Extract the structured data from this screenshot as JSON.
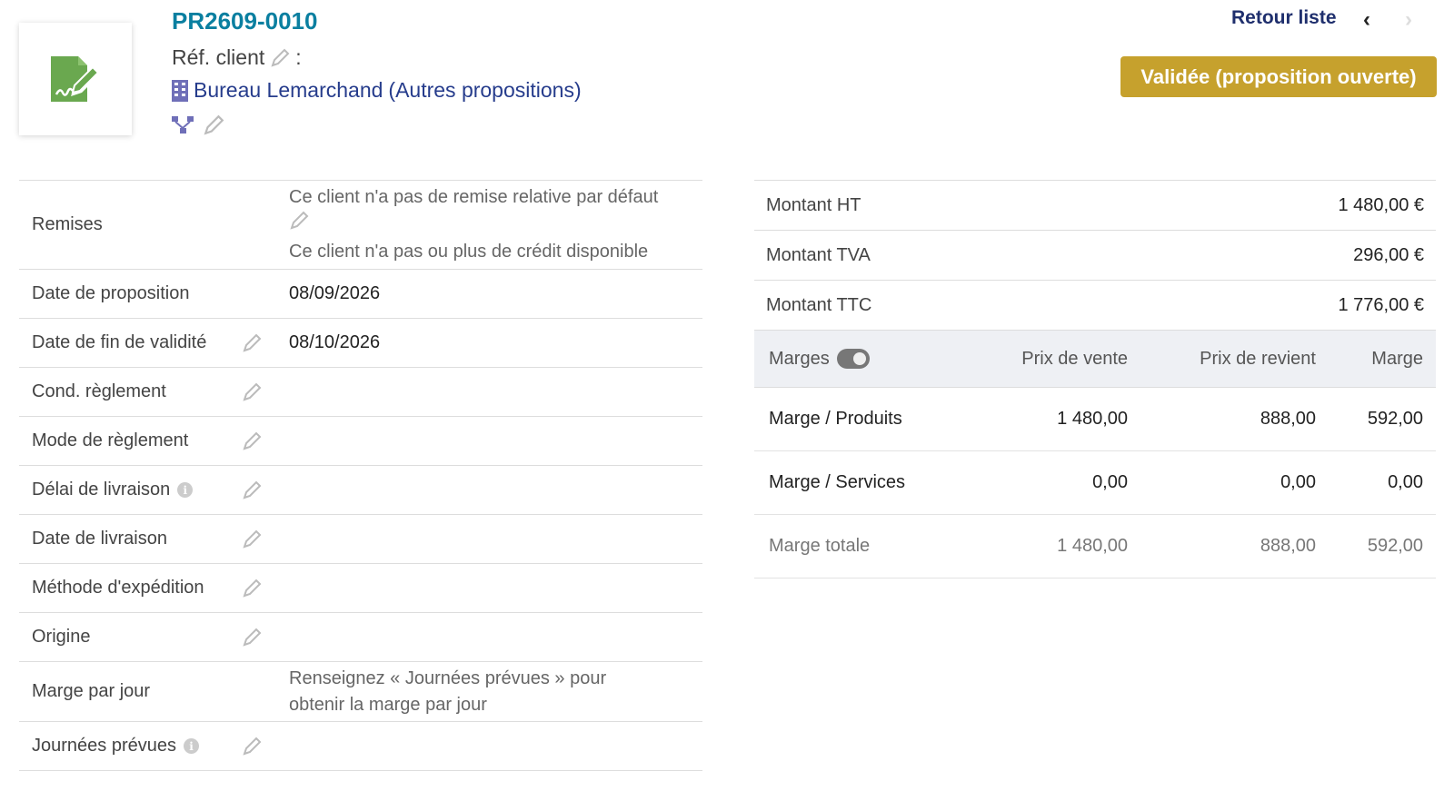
{
  "header": {
    "ref": "PR2609-0010",
    "ref_client_label": "Réf. client",
    "ref_client_sep": ":",
    "thirdparty_name": "Bureau Lemarchand",
    "other_proposals": "(Autres propositions)",
    "back_to_list": "Retour liste",
    "prev_symbol": "‹",
    "next_symbol": "›",
    "status": "Validée (proposition ouverte)",
    "status_color": "#c6a12d",
    "ref_color": "#0a7fa0",
    "icon_logo": "signature-document-icon"
  },
  "left_rows": [
    {
      "label": "Remises",
      "value_lines": [
        "Ce client n'a pas de remise relative par défaut",
        "Ce client n'a pas ou plus de crédit disponible"
      ]
    },
    {
      "label": "Date de proposition",
      "value": "08/09/2026"
    },
    {
      "label": "Date de fin de validité",
      "value": "08/10/2026"
    },
    {
      "label": "Cond. règlement",
      "value": ""
    },
    {
      "label": "Mode de règlement",
      "value": ""
    },
    {
      "label": "Délai de livraison",
      "value": ""
    },
    {
      "label": "Date de livraison",
      "value": ""
    },
    {
      "label": "Méthode d'expédition",
      "value": ""
    },
    {
      "label": "Origine",
      "value": ""
    },
    {
      "label": "Marge par jour",
      "value_lines": [
        "Renseignez « Journées prévues » pour",
        "obtenir la marge par jour"
      ]
    },
    {
      "label": "Journées prévues",
      "value": ""
    }
  ],
  "amounts": [
    {
      "label": "Montant HT",
      "value": "1 480,00 €"
    },
    {
      "label": "Montant TVA",
      "value": "296,00 €"
    },
    {
      "label": "Montant TTC",
      "value": "1 776,00 €"
    }
  ],
  "margins": {
    "head": {
      "label": "Marges",
      "sale": "Prix de vente",
      "cost": "Prix de revient",
      "margin": "Marge"
    },
    "rows": [
      {
        "label": "Marge / Produits",
        "sale": "1 480,00",
        "cost": "888,00",
        "margin": "592,00"
      },
      {
        "label": "Marge / Services",
        "sale": "0,00",
        "cost": "0,00",
        "margin": "0,00"
      },
      {
        "label": "Marge totale",
        "sale": "1 480,00",
        "cost": "888,00",
        "margin": "592,00"
      }
    ]
  }
}
